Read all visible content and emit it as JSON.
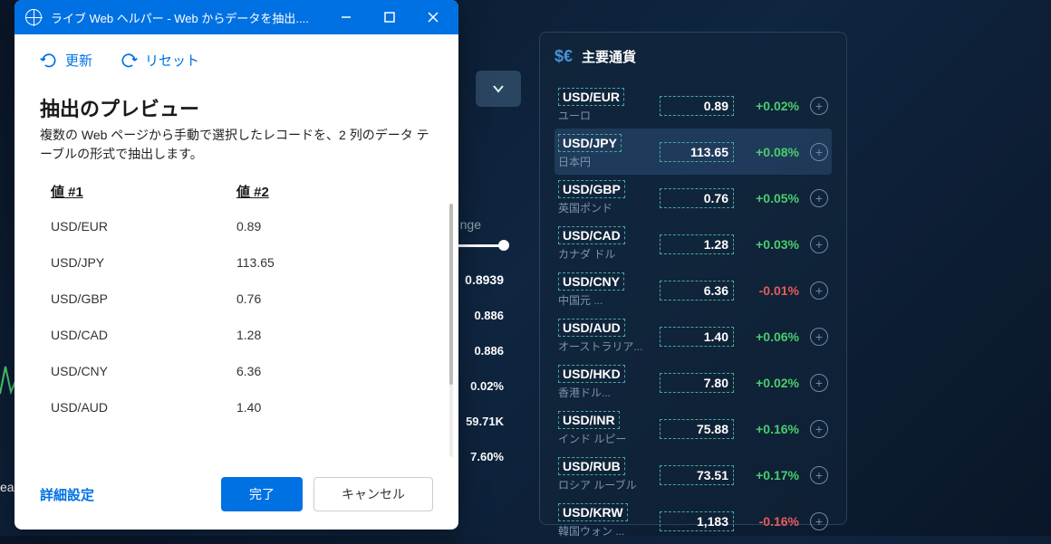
{
  "background": {
    "chevron": "⌄",
    "nge_label": "nge",
    "stats": [
      {
        "v": "0.8939"
      },
      {
        "v": "0.886"
      },
      {
        "v": "0.886"
      },
      {
        "v": "0.02%"
      },
      {
        "v": "59.71K"
      },
      {
        "v": "7.60%"
      }
    ],
    "peek": "ea"
  },
  "currencyPanel": {
    "icon": "$€",
    "title": "主要通貨",
    "rows": [
      {
        "pair": "USD/EUR",
        "name": "ユーロ",
        "rate": "0.89",
        "change": "+0.02%",
        "pos": true
      },
      {
        "pair": "USD/JPY",
        "name": "日本円",
        "rate": "113.65",
        "change": "+0.08%",
        "pos": true,
        "highlight": true
      },
      {
        "pair": "USD/GBP",
        "name": "英国ポンド",
        "rate": "0.76",
        "change": "+0.05%",
        "pos": true
      },
      {
        "pair": "USD/CAD",
        "name": "カナダ ドル",
        "rate": "1.28",
        "change": "+0.03%",
        "pos": true
      },
      {
        "pair": "USD/CNY",
        "name": "中国元 ...",
        "rate": "6.36",
        "change": "-0.01%",
        "pos": false
      },
      {
        "pair": "USD/AUD",
        "name": "オーストラリア...",
        "rate": "1.40",
        "change": "+0.06%",
        "pos": true
      },
      {
        "pair": "USD/HKD",
        "name": "香港ドル...",
        "rate": "7.80",
        "change": "+0.02%",
        "pos": true
      },
      {
        "pair": "USD/INR",
        "name": "インド ルピー",
        "rate": "75.88",
        "change": "+0.16%",
        "pos": true
      },
      {
        "pair": "USD/RUB",
        "name": "ロシア ルーブル",
        "rate": "73.51",
        "change": "+0.17%",
        "pos": true
      },
      {
        "pair": "USD/KRW",
        "name": "韓国ウォン ...",
        "rate": "1,183",
        "change": "-0.16%",
        "pos": false
      }
    ]
  },
  "dialog": {
    "title": "ライブ Web ヘルパー - Web からデータを抽出....",
    "toolbar": {
      "refresh": "更新",
      "reset": "リセット"
    },
    "previewTitle": "抽出のプレビュー",
    "previewDesc": "複数の Web ページから手動で選択したレコードを、2 列のデータ テーブルの形式で抽出します。",
    "columns": [
      "値 #1",
      "値 #2"
    ],
    "rows": [
      [
        "USD/EUR",
        "0.89"
      ],
      [
        "USD/JPY",
        "113.65"
      ],
      [
        "USD/GBP",
        "0.76"
      ],
      [
        "USD/CAD",
        "1.28"
      ],
      [
        "USD/CNY",
        "6.36"
      ],
      [
        "USD/AUD",
        "1.40"
      ]
    ],
    "footer": {
      "advanced": "詳細設定",
      "done": "完了",
      "cancel": "キャンセル"
    }
  }
}
